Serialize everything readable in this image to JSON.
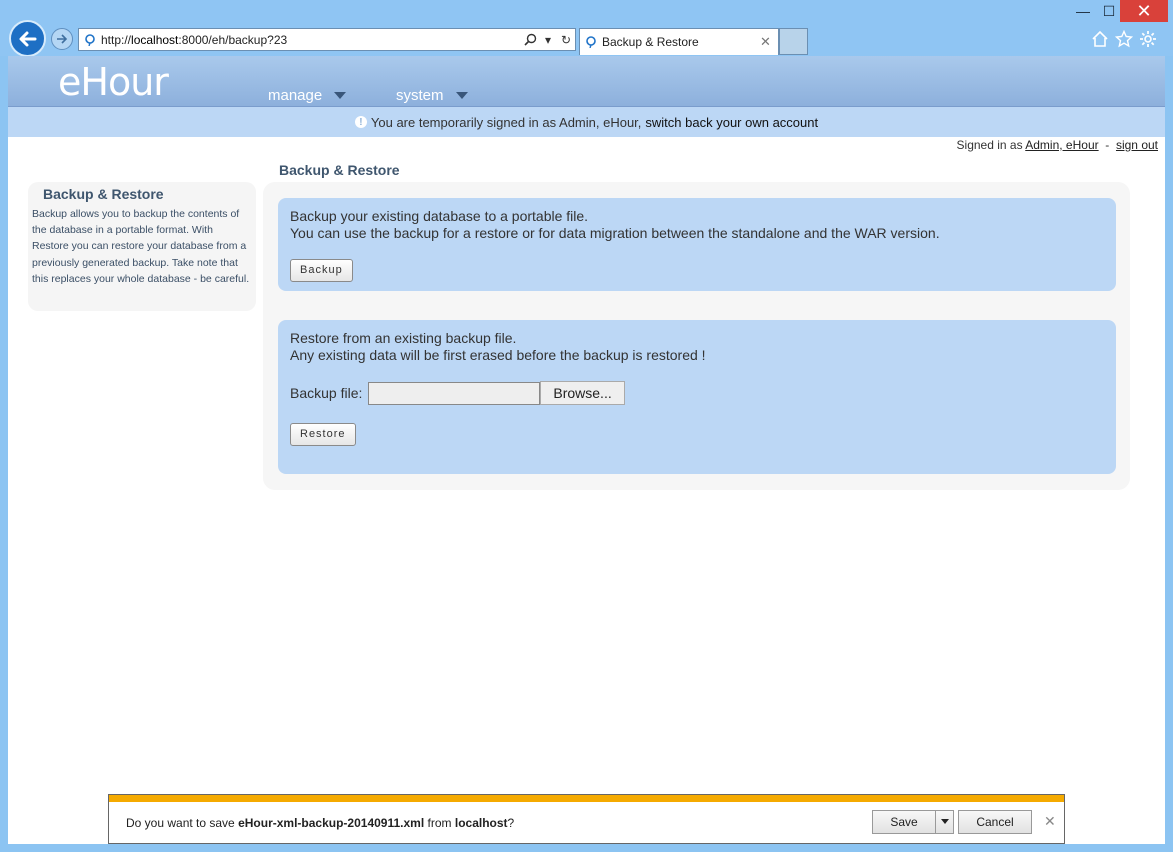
{
  "browser": {
    "url_prefix": "http://",
    "url_host": "localhost",
    "url_path": ":8000/eh/backup?23",
    "tab_title": "Backup & Restore"
  },
  "app": {
    "logo": "eHour",
    "nav": {
      "manage": "manage",
      "system": "system"
    },
    "notice": {
      "text": "You are temporarily signed in as Admin, eHour,",
      "link": "switch back your own account"
    },
    "signed_in": {
      "prefix": "Signed in as",
      "user": "Admin, eHour",
      "separator": "-",
      "sign_out": "sign out"
    }
  },
  "page": {
    "title": "Backup & Restore",
    "sidebar": {
      "title": "Backup & Restore",
      "text": "Backup allows you to backup the contents of the database in a portable format. With Restore you can restore your database from a previously generated backup. Take note that this replaces your whole database - be careful."
    },
    "backup": {
      "line1": "Backup your existing database to a portable file.",
      "line2": "You can use the backup for a restore or for data migration between the standalone and the WAR version.",
      "button": "Backup"
    },
    "restore": {
      "line1": "Restore from an existing backup file.",
      "line2": "Any existing data will be first erased before the backup is restored !",
      "file_label": "Backup file:",
      "browse": "Browse...",
      "button": "Restore"
    }
  },
  "download": {
    "prefix": "Do you want to save",
    "filename": "eHour-xml-backup-20140911.xml",
    "middle": "from",
    "host": "localhost",
    "suffix": "?",
    "save": "Save",
    "cancel": "Cancel"
  }
}
